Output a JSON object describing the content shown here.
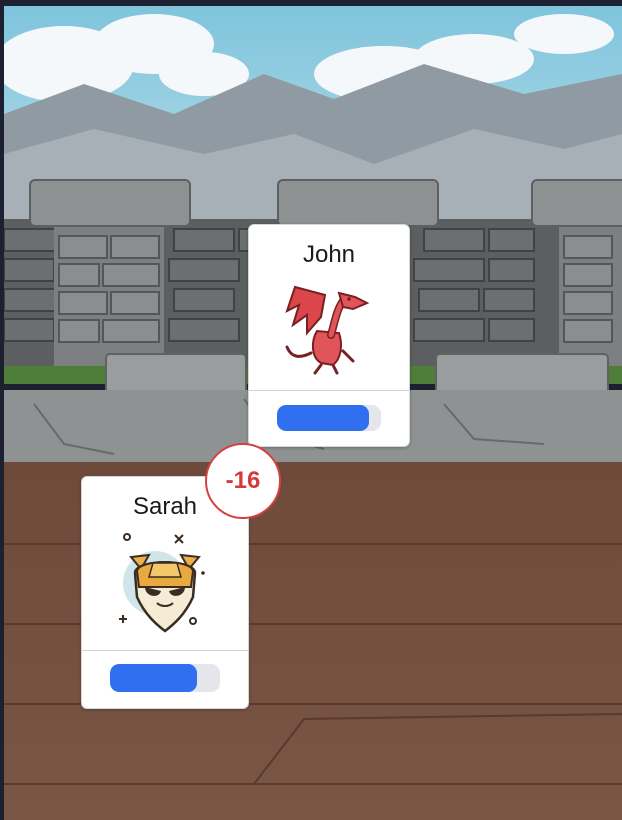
{
  "colors": {
    "hp_fill": "#2f6ff0",
    "hp_track": "#e4e6ec",
    "damage_text": "#d43a3a",
    "card_bg": "#ffffff"
  },
  "players": [
    {
      "name": "John",
      "avatar": "red-dragon-icon",
      "hp_fraction": 0.88
    },
    {
      "name": "Sarah",
      "avatar": "armored-shield-creature-icon",
      "hp_fraction": 0.79
    }
  ],
  "damage_badge": {
    "text": "-16"
  }
}
